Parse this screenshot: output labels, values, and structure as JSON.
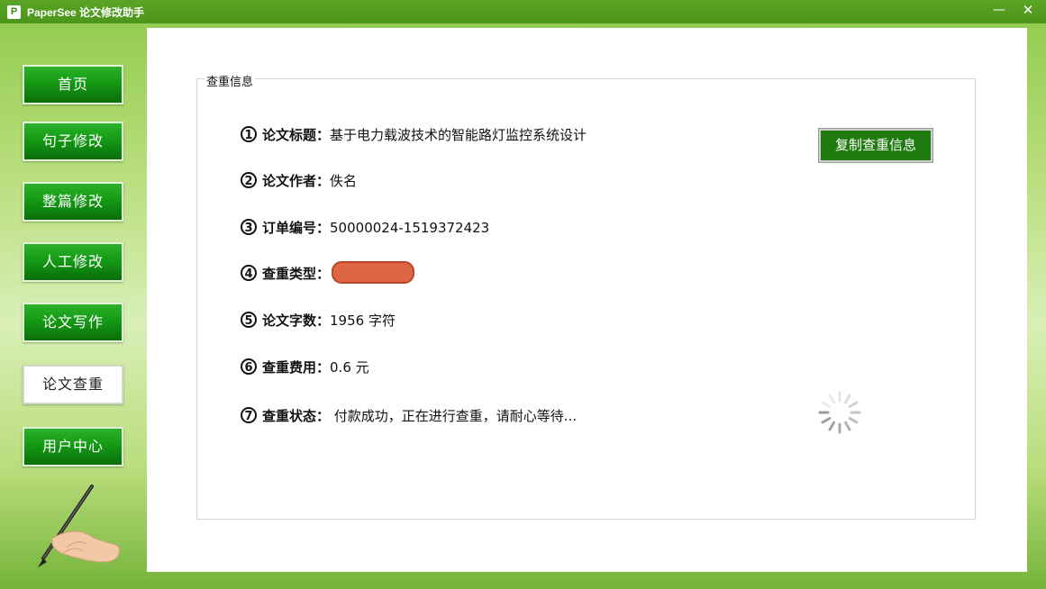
{
  "window": {
    "icon_letter": "P",
    "title": "PaperSee 论文修改助手",
    "minimize": "—",
    "close": "✕"
  },
  "sidebar": {
    "items": [
      {
        "label": "首页",
        "active": false
      },
      {
        "label": "句子修改",
        "active": false
      },
      {
        "label": "整篇修改",
        "active": false
      },
      {
        "label": "人工修改",
        "active": false
      },
      {
        "label": "论文写作",
        "active": false
      },
      {
        "label": "论文查重",
        "active": true
      },
      {
        "label": "用户中心",
        "active": false
      }
    ]
  },
  "main": {
    "group_title": "查重信息",
    "copy_button": "复制查重信息",
    "rows": [
      {
        "num": "1",
        "label": "论文标题：",
        "value": "基于电力载波技术的智能路灯监控系统设计"
      },
      {
        "num": "2",
        "label": "论文作者：",
        "value": "佚名"
      },
      {
        "num": "3",
        "label": "订单编号：",
        "value": "50000024-1519372423"
      },
      {
        "num": "4",
        "label": "查重类型：",
        "value": ""
      },
      {
        "num": "5",
        "label": "论文字数：",
        "value": "1956 字符"
      },
      {
        "num": "6",
        "label": "查重费用：",
        "value": "0.6 元"
      },
      {
        "num": "7",
        "label": "查重状态：",
        "value": " 付款成功，正在进行查重，请耐心等待..."
      }
    ]
  },
  "colors": {
    "accent_green": "#1f7b0d",
    "title_bar": "#4b951c",
    "redaction": "#de6645"
  }
}
